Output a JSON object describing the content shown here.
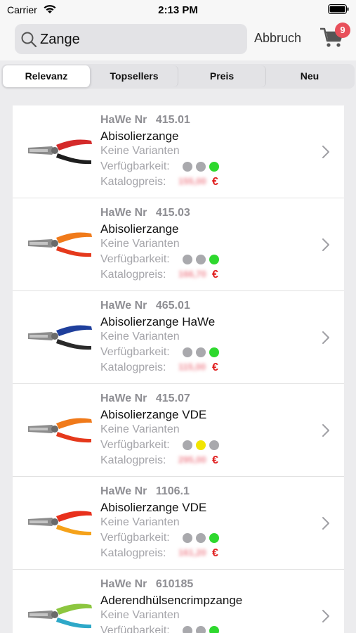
{
  "status_bar": {
    "carrier": "Carrier",
    "time": "2:13 PM"
  },
  "search": {
    "value": "Zange",
    "cancel_label": "Abbruch"
  },
  "cart": {
    "badge_count": "9"
  },
  "segments": [
    {
      "label": "Relevanz",
      "active": true
    },
    {
      "label": "Topsellers",
      "active": false
    },
    {
      "label": "Preis",
      "active": false
    },
    {
      "label": "Neu",
      "active": false
    }
  ],
  "labels": {
    "nr_prefix": "HaWe Nr",
    "variants": "Keine Varianten",
    "availability": "Verfügbarkeit:",
    "price": "Katalogpreis:",
    "currency": "€"
  },
  "colors": {
    "gray_dot": "#a9a9ad",
    "green_dot": "#2ed82e",
    "yellow_dot": "#f2e500",
    "price_red": "#e02020",
    "badge": "#e8505b"
  },
  "products": [
    {
      "nr": "415.01",
      "name": "Abisolierzange",
      "price": "155,00",
      "availability": [
        "gray",
        "gray",
        "green"
      ],
      "pliers": "red"
    },
    {
      "nr": "415.03",
      "name": "Abisolierzange",
      "price": "166,70",
      "availability": [
        "gray",
        "gray",
        "green"
      ],
      "pliers": "orange"
    },
    {
      "nr": "465.01",
      "name": "Abisolierzange HaWe",
      "price": "115,00",
      "availability": [
        "gray",
        "gray",
        "green"
      ],
      "pliers": "blue"
    },
    {
      "nr": "415.07",
      "name": "Abisolierzange VDE",
      "price": "295,00",
      "availability": [
        "gray",
        "yellow",
        "gray"
      ],
      "pliers": "orange"
    },
    {
      "nr": "1106.1",
      "name": "Abisolierzange VDE",
      "price": "161,20",
      "availability": [
        "gray",
        "gray",
        "green"
      ],
      "pliers": "redorange"
    },
    {
      "nr": "610185",
      "name": "Aderendhülsencrimpzange",
      "price": "",
      "availability": [
        "gray",
        "gray",
        "green"
      ],
      "pliers": "green"
    }
  ]
}
